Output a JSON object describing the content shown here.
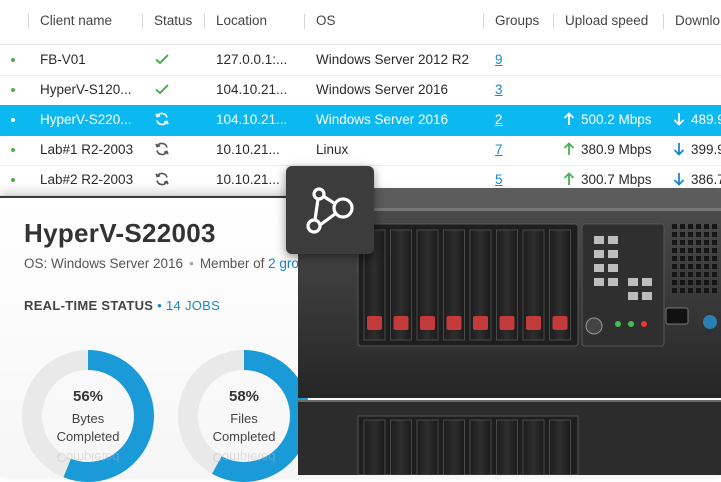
{
  "table": {
    "columns": {
      "client_name": "Client name",
      "status": "Status",
      "location": "Location",
      "os": "OS",
      "groups": "Groups",
      "upload_speed": "Upload speed",
      "download_speed": "Downlo"
    },
    "rows": [
      {
        "client": "FB-V01",
        "status": "ok",
        "location": "127.0.0.1:...",
        "os": "Windows Server 2012 R2",
        "groups": "9",
        "upload": "",
        "download": "",
        "selected": false
      },
      {
        "client": "HyperV-S120...",
        "status": "ok",
        "location": "104.10.21...",
        "os": "Windows Server 2016",
        "groups": "3",
        "upload": "",
        "download": "",
        "selected": false
      },
      {
        "client": "HyperV-S220...",
        "status": "syncing",
        "location": "104.10.21...",
        "os": "Windows Server 2016",
        "groups": "2",
        "upload": "500.2 Mbps",
        "download": "489.9",
        "selected": true
      },
      {
        "client": "Lab#1 R2-2003",
        "status": "syncing",
        "location": "10.10.21...",
        "os": "Linux",
        "groups": "7",
        "upload": "380.9 Mbps",
        "download": "399.9",
        "selected": false
      },
      {
        "client": "Lab#2 R2-2003",
        "status": "syncing",
        "location": "10.10.21...",
        "os": "",
        "groups": "5",
        "upload": "300.7 Mbps",
        "download": "386.7",
        "selected": false
      }
    ]
  },
  "detail": {
    "title": "HyperV-S22003",
    "os_label": "OS: Windows Server 2016",
    "member_of_prefix": "Member of",
    "member_of_link": "2 gro",
    "realtime_label": "REAL-TIME STATUS",
    "jobs_link": "14 JOBS",
    "gauges": [
      {
        "percent_text": "56%",
        "label_line1": "Bytes",
        "label_line2": "Completed",
        "reflection": "Completed",
        "fraction": 0.56
      },
      {
        "percent_text": "58%",
        "label_line1": "Files",
        "label_line2": "Completed",
        "reflection": "Completed",
        "fraction": 0.58
      }
    ]
  },
  "icons": {
    "status_ok": "check-icon",
    "status_syncing": "sync-icon",
    "upload": "arrow-up-icon",
    "download": "arrow-down-icon",
    "logo": "network-nodes-logo-icon",
    "server": "rack-server-image"
  },
  "colors": {
    "accent": "#0cb8f0",
    "link": "#1a86c8",
    "ok_green": "#4caf50",
    "gauge_fill": "#1a9ad6",
    "gauge_track": "#e9e9e9"
  }
}
